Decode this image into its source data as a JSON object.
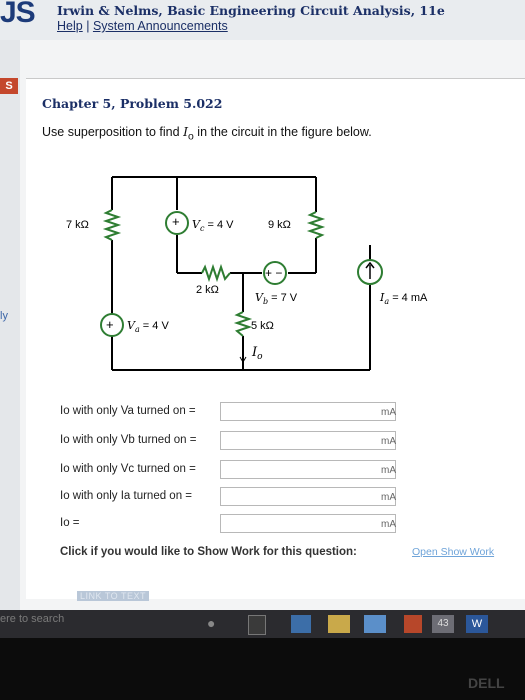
{
  "header": {
    "logo": "JS",
    "book_title": "Irwin & Nelms, Basic Engineering Circuit Analysis, 11e",
    "help_link": "Help",
    "separator": "|",
    "announcements_link": "System Announcements"
  },
  "left_strip": {
    "tab_s": "S",
    "tab_ly": "ly"
  },
  "problem": {
    "chapter": "Chapter 5, Problem 5.022",
    "question_prefix": "Use superposition to find ",
    "question_var": "I",
    "question_sub": "o",
    "question_suffix": " in the circuit in the figure below."
  },
  "circuit": {
    "r1": "7 kΩ",
    "r2": "9 kΩ",
    "r3": "2 kΩ",
    "r4": "5 kΩ",
    "vc_label": "V",
    "vc_sub": "c",
    "vc_value": " = 4 V",
    "vb_label": "V",
    "vb_sub": "b",
    "vb_value": " = 7 V",
    "va_label": "V",
    "va_sub": "a",
    "va_value": " = 4 V",
    "ia_label": "I",
    "ia_sub": "a",
    "ia_value": " = 4 mA",
    "io_label": "I",
    "io_sub": "o"
  },
  "answers": [
    {
      "label": "Io with only Va turned on =",
      "unit": "mA",
      "value": ""
    },
    {
      "label": "Io with only Vb turned on =",
      "unit": "mA",
      "value": ""
    },
    {
      "label": "Io with only Vc turned on =",
      "unit": "mA",
      "value": ""
    },
    {
      "label": "Io with only Ia turned on =",
      "unit": "mA",
      "value": ""
    },
    {
      "label": "Io =",
      "unit": "mA",
      "value": ""
    }
  ],
  "footer": {
    "click_text": "Click if you would like to Show Work for this question:",
    "show_work_link": "Open Show Work",
    "link_to_text": "LINK TO TEXT"
  },
  "taskbar": {
    "search_text": "ere to search",
    "badge": "43"
  },
  "bezel_logo": "DELL"
}
